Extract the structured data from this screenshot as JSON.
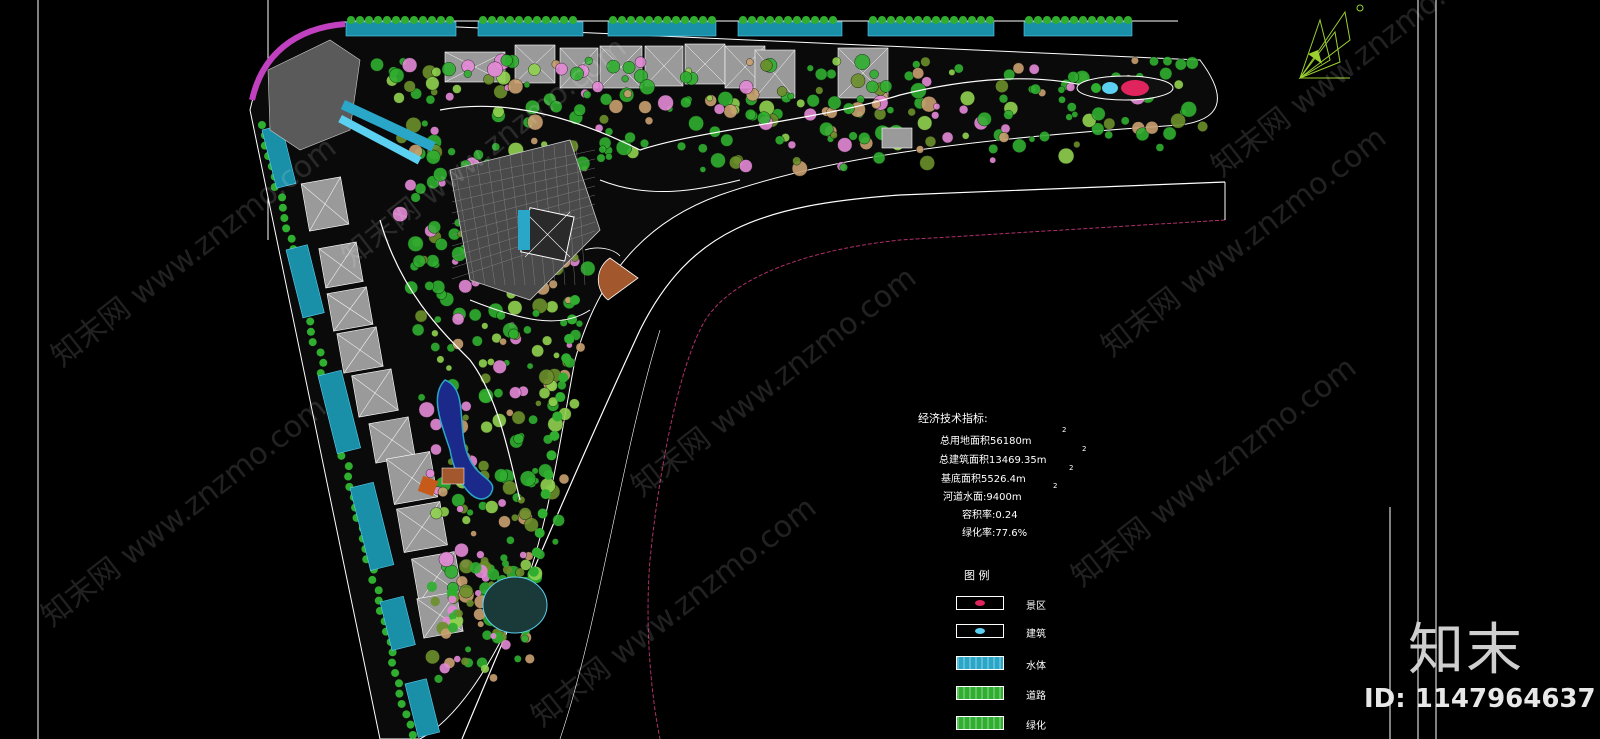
{
  "stats": {
    "heading": "经济技术指标:",
    "lines": [
      {
        "text": "总用地面积56180m",
        "sup": "2"
      },
      {
        "text": "总建筑面积13469.35m",
        "sup": "2"
      },
      {
        "text": "基底面积5526.4m",
        "sup": "2"
      },
      {
        "text": "河道水面:9400m",
        "sup": "2"
      },
      {
        "text": "容积率:0.24",
        "sup": ""
      },
      {
        "text": "绿化率:77.6%",
        "sup": ""
      }
    ]
  },
  "legend": {
    "title": "图 例",
    "items": [
      {
        "label": "景区",
        "swatch": "#000000",
        "mark": "#e0245e"
      },
      {
        "label": "建筑",
        "swatch": "#000000",
        "mark": "#5bd0f0"
      },
      {
        "label": "水体",
        "swatch": "#2aa6c8",
        "mark": ""
      },
      {
        "label": "道路",
        "swatch": "#2fae2f",
        "mark": ""
      },
      {
        "label": "绿化",
        "swatch": "#2fae2f",
        "mark": ""
      }
    ]
  },
  "watermark": {
    "brand": "知末",
    "id_text": "ID: 1147964637",
    "url": "www.znzmo.com",
    "site_cn": "知末网"
  },
  "colors": {
    "building": "#9a9a9a",
    "tree_green": "#2fae2f",
    "tree_olive": "#6c8f2a",
    "tree_tan": "#c9a070",
    "tree_pink": "#e48ad6",
    "water": "#2aa6c8",
    "pavilion": "#a3572d",
    "road_line": "#ffffff",
    "boundary": "#b0306a"
  }
}
